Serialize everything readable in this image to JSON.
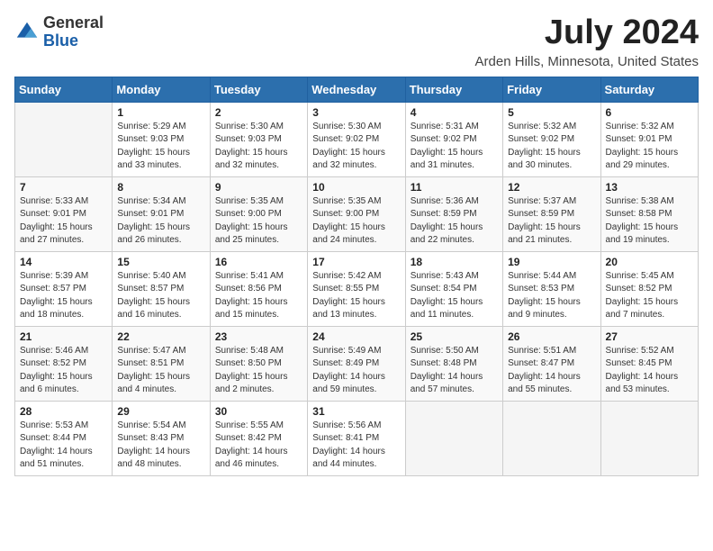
{
  "header": {
    "logo_general": "General",
    "logo_blue": "Blue",
    "month_year": "July 2024",
    "location": "Arden Hills, Minnesota, United States"
  },
  "weekdays": [
    "Sunday",
    "Monday",
    "Tuesday",
    "Wednesday",
    "Thursday",
    "Friday",
    "Saturday"
  ],
  "weeks": [
    [
      {
        "day": "",
        "info": ""
      },
      {
        "day": "1",
        "info": "Sunrise: 5:29 AM\nSunset: 9:03 PM\nDaylight: 15 hours\nand 33 minutes."
      },
      {
        "day": "2",
        "info": "Sunrise: 5:30 AM\nSunset: 9:03 PM\nDaylight: 15 hours\nand 32 minutes."
      },
      {
        "day": "3",
        "info": "Sunrise: 5:30 AM\nSunset: 9:02 PM\nDaylight: 15 hours\nand 32 minutes."
      },
      {
        "day": "4",
        "info": "Sunrise: 5:31 AM\nSunset: 9:02 PM\nDaylight: 15 hours\nand 31 minutes."
      },
      {
        "day": "5",
        "info": "Sunrise: 5:32 AM\nSunset: 9:02 PM\nDaylight: 15 hours\nand 30 minutes."
      },
      {
        "day": "6",
        "info": "Sunrise: 5:32 AM\nSunset: 9:01 PM\nDaylight: 15 hours\nand 29 minutes."
      }
    ],
    [
      {
        "day": "7",
        "info": "Sunrise: 5:33 AM\nSunset: 9:01 PM\nDaylight: 15 hours\nand 27 minutes."
      },
      {
        "day": "8",
        "info": "Sunrise: 5:34 AM\nSunset: 9:01 PM\nDaylight: 15 hours\nand 26 minutes."
      },
      {
        "day": "9",
        "info": "Sunrise: 5:35 AM\nSunset: 9:00 PM\nDaylight: 15 hours\nand 25 minutes."
      },
      {
        "day": "10",
        "info": "Sunrise: 5:35 AM\nSunset: 9:00 PM\nDaylight: 15 hours\nand 24 minutes."
      },
      {
        "day": "11",
        "info": "Sunrise: 5:36 AM\nSunset: 8:59 PM\nDaylight: 15 hours\nand 22 minutes."
      },
      {
        "day": "12",
        "info": "Sunrise: 5:37 AM\nSunset: 8:59 PM\nDaylight: 15 hours\nand 21 minutes."
      },
      {
        "day": "13",
        "info": "Sunrise: 5:38 AM\nSunset: 8:58 PM\nDaylight: 15 hours\nand 19 minutes."
      }
    ],
    [
      {
        "day": "14",
        "info": "Sunrise: 5:39 AM\nSunset: 8:57 PM\nDaylight: 15 hours\nand 18 minutes."
      },
      {
        "day": "15",
        "info": "Sunrise: 5:40 AM\nSunset: 8:57 PM\nDaylight: 15 hours\nand 16 minutes."
      },
      {
        "day": "16",
        "info": "Sunrise: 5:41 AM\nSunset: 8:56 PM\nDaylight: 15 hours\nand 15 minutes."
      },
      {
        "day": "17",
        "info": "Sunrise: 5:42 AM\nSunset: 8:55 PM\nDaylight: 15 hours\nand 13 minutes."
      },
      {
        "day": "18",
        "info": "Sunrise: 5:43 AM\nSunset: 8:54 PM\nDaylight: 15 hours\nand 11 minutes."
      },
      {
        "day": "19",
        "info": "Sunrise: 5:44 AM\nSunset: 8:53 PM\nDaylight: 15 hours\nand 9 minutes."
      },
      {
        "day": "20",
        "info": "Sunrise: 5:45 AM\nSunset: 8:52 PM\nDaylight: 15 hours\nand 7 minutes."
      }
    ],
    [
      {
        "day": "21",
        "info": "Sunrise: 5:46 AM\nSunset: 8:52 PM\nDaylight: 15 hours\nand 6 minutes."
      },
      {
        "day": "22",
        "info": "Sunrise: 5:47 AM\nSunset: 8:51 PM\nDaylight: 15 hours\nand 4 minutes."
      },
      {
        "day": "23",
        "info": "Sunrise: 5:48 AM\nSunset: 8:50 PM\nDaylight: 15 hours\nand 2 minutes."
      },
      {
        "day": "24",
        "info": "Sunrise: 5:49 AM\nSunset: 8:49 PM\nDaylight: 14 hours\nand 59 minutes."
      },
      {
        "day": "25",
        "info": "Sunrise: 5:50 AM\nSunset: 8:48 PM\nDaylight: 14 hours\nand 57 minutes."
      },
      {
        "day": "26",
        "info": "Sunrise: 5:51 AM\nSunset: 8:47 PM\nDaylight: 14 hours\nand 55 minutes."
      },
      {
        "day": "27",
        "info": "Sunrise: 5:52 AM\nSunset: 8:45 PM\nDaylight: 14 hours\nand 53 minutes."
      }
    ],
    [
      {
        "day": "28",
        "info": "Sunrise: 5:53 AM\nSunset: 8:44 PM\nDaylight: 14 hours\nand 51 minutes."
      },
      {
        "day": "29",
        "info": "Sunrise: 5:54 AM\nSunset: 8:43 PM\nDaylight: 14 hours\nand 48 minutes."
      },
      {
        "day": "30",
        "info": "Sunrise: 5:55 AM\nSunset: 8:42 PM\nDaylight: 14 hours\nand 46 minutes."
      },
      {
        "day": "31",
        "info": "Sunrise: 5:56 AM\nSunset: 8:41 PM\nDaylight: 14 hours\nand 44 minutes."
      },
      {
        "day": "",
        "info": ""
      },
      {
        "day": "",
        "info": ""
      },
      {
        "day": "",
        "info": ""
      }
    ]
  ]
}
